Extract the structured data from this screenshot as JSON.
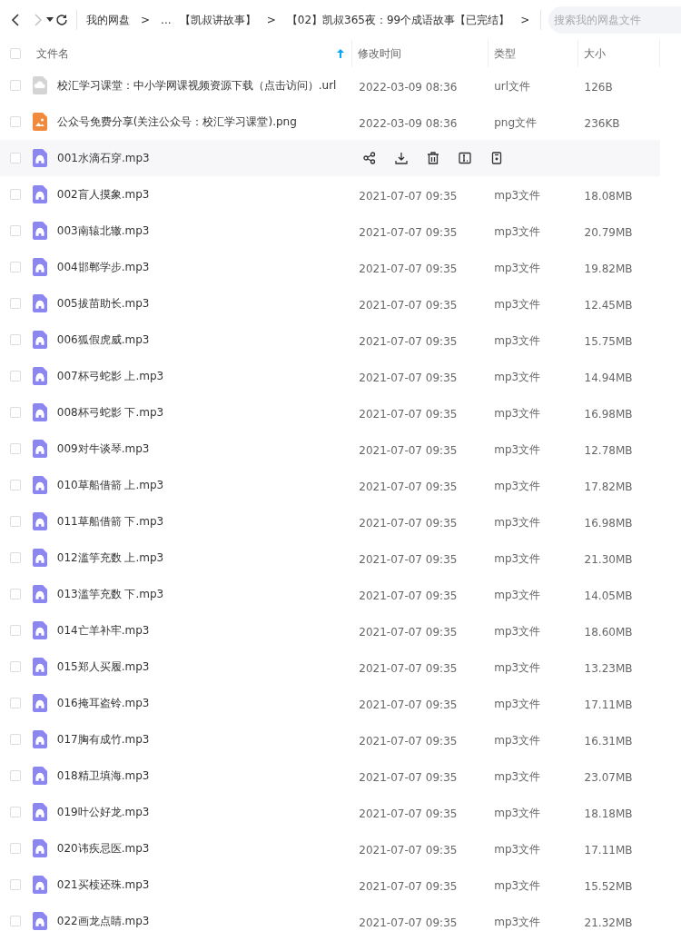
{
  "toolbar": {
    "back": {
      "disabled": false
    },
    "forward": {
      "disabled": true
    },
    "breadcrumb": [
      {
        "label": "我的网盘",
        "separator": ">"
      },
      {
        "label": "..."
      },
      {
        "label": "【凯叔讲故事】",
        "separator": ">"
      },
      {
        "label": "【02】凯叔365夜：99个成语故事【已完结】",
        "separator": ">"
      }
    ],
    "search": {
      "placeholder": "搜索我的网盘文件"
    }
  },
  "table": {
    "select_all_checked": false,
    "columns": [
      {
        "label": "文件名",
        "sorted": true
      },
      {
        "label": "修改时间",
        "sorted": false
      },
      {
        "label": "类型",
        "sorted": false
      },
      {
        "label": "大小",
        "sorted": false
      }
    ],
    "rows": [
      {
        "kind": "url",
        "name": "校汇学习课堂：中小学网课视频资源下载（点击访问）.url",
        "date": "2022-03-09 08:36",
        "type": "url文件",
        "size": "126B",
        "hovered": false,
        "checked": false
      },
      {
        "kind": "image",
        "name": "公众号免费分享(关注公众号：校汇学习课堂).png",
        "date": "2022-03-09 08:36",
        "type": "png文件",
        "size": "236KB",
        "hovered": false,
        "checked": false
      },
      {
        "kind": "audio",
        "name": "001水滴石穿.mp3",
        "hovered": true,
        "checked": false
      },
      {
        "kind": "audio",
        "name": "002盲人摸象.mp3",
        "date": "2021-07-07 09:35",
        "type": "mp3文件",
        "size": "18.08MB",
        "hovered": false,
        "checked": false
      },
      {
        "kind": "audio",
        "name": "003南辕北辙.mp3",
        "date": "2021-07-07 09:35",
        "type": "mp3文件",
        "size": "20.79MB",
        "hovered": false,
        "checked": false
      },
      {
        "kind": "audio",
        "name": "004邯郸学步.mp3",
        "date": "2021-07-07 09:35",
        "type": "mp3文件",
        "size": "19.82MB",
        "hovered": false,
        "checked": false
      },
      {
        "kind": "audio",
        "name": "005拔苗助长.mp3",
        "date": "2021-07-07 09:35",
        "type": "mp3文件",
        "size": "12.45MB",
        "hovered": false,
        "checked": false
      },
      {
        "kind": "audio",
        "name": "006狐假虎威.mp3",
        "date": "2021-07-07 09:35",
        "type": "mp3文件",
        "size": "15.75MB",
        "hovered": false,
        "checked": false
      },
      {
        "kind": "audio",
        "name": "007杯弓蛇影 上.mp3",
        "date": "2021-07-07 09:35",
        "type": "mp3文件",
        "size": "14.94MB",
        "hovered": false,
        "checked": false
      },
      {
        "kind": "audio",
        "name": "008杯弓蛇影 下.mp3",
        "date": "2021-07-07 09:35",
        "type": "mp3文件",
        "size": "16.98MB",
        "hovered": false,
        "checked": false
      },
      {
        "kind": "audio",
        "name": "009对牛谈琴.mp3",
        "date": "2021-07-07 09:35",
        "type": "mp3文件",
        "size": "12.78MB",
        "hovered": false,
        "checked": false
      },
      {
        "kind": "audio",
        "name": "010草船借箭 上.mp3",
        "date": "2021-07-07 09:35",
        "type": "mp3文件",
        "size": "17.82MB",
        "hovered": false,
        "checked": false
      },
      {
        "kind": "audio",
        "name": "011草船借箭 下.mp3",
        "date": "2021-07-07 09:35",
        "type": "mp3文件",
        "size": "16.98MB",
        "hovered": false,
        "checked": false
      },
      {
        "kind": "audio",
        "name": "012滥竽充数 上.mp3",
        "date": "2021-07-07 09:35",
        "type": "mp3文件",
        "size": "21.30MB",
        "hovered": false,
        "checked": false
      },
      {
        "kind": "audio",
        "name": "013滥竽充数 下.mp3",
        "date": "2021-07-07 09:35",
        "type": "mp3文件",
        "size": "14.05MB",
        "hovered": false,
        "checked": false
      },
      {
        "kind": "audio",
        "name": "014亡羊补牢.mp3",
        "date": "2021-07-07 09:35",
        "type": "mp3文件",
        "size": "18.60MB",
        "hovered": false,
        "checked": false
      },
      {
        "kind": "audio",
        "name": "015郑人买履.mp3",
        "date": "2021-07-07 09:35",
        "type": "mp3文件",
        "size": "13.23MB",
        "hovered": false,
        "checked": false
      },
      {
        "kind": "audio",
        "name": "016掩耳盗铃.mp3",
        "date": "2021-07-07 09:35",
        "type": "mp3文件",
        "size": "17.11MB",
        "hovered": false,
        "checked": false
      },
      {
        "kind": "audio",
        "name": "017胸有成竹.mp3",
        "date": "2021-07-07 09:35",
        "type": "mp3文件",
        "size": "16.31MB",
        "hovered": false,
        "checked": false
      },
      {
        "kind": "audio",
        "name": "018精卫填海.mp3",
        "date": "2021-07-07 09:35",
        "type": "mp3文件",
        "size": "23.07MB",
        "hovered": false,
        "checked": false
      },
      {
        "kind": "audio",
        "name": "019叶公好龙.mp3",
        "date": "2021-07-07 09:35",
        "type": "mp3文件",
        "size": "18.18MB",
        "hovered": false,
        "checked": false
      },
      {
        "kind": "audio",
        "name": "020讳疾忌医.mp3",
        "date": "2021-07-07 09:35",
        "type": "mp3文件",
        "size": "17.11MB",
        "hovered": false,
        "checked": false
      },
      {
        "kind": "audio",
        "name": "021买椟还珠.mp3",
        "date": "2021-07-07 09:35",
        "type": "mp3文件",
        "size": "15.52MB",
        "hovered": false,
        "checked": false
      },
      {
        "kind": "audio",
        "name": "022画龙点睛.mp3",
        "date": "2021-07-07 09:35",
        "type": "mp3文件",
        "size": "21.32MB",
        "hovered": false,
        "checked": false
      }
    ]
  }
}
